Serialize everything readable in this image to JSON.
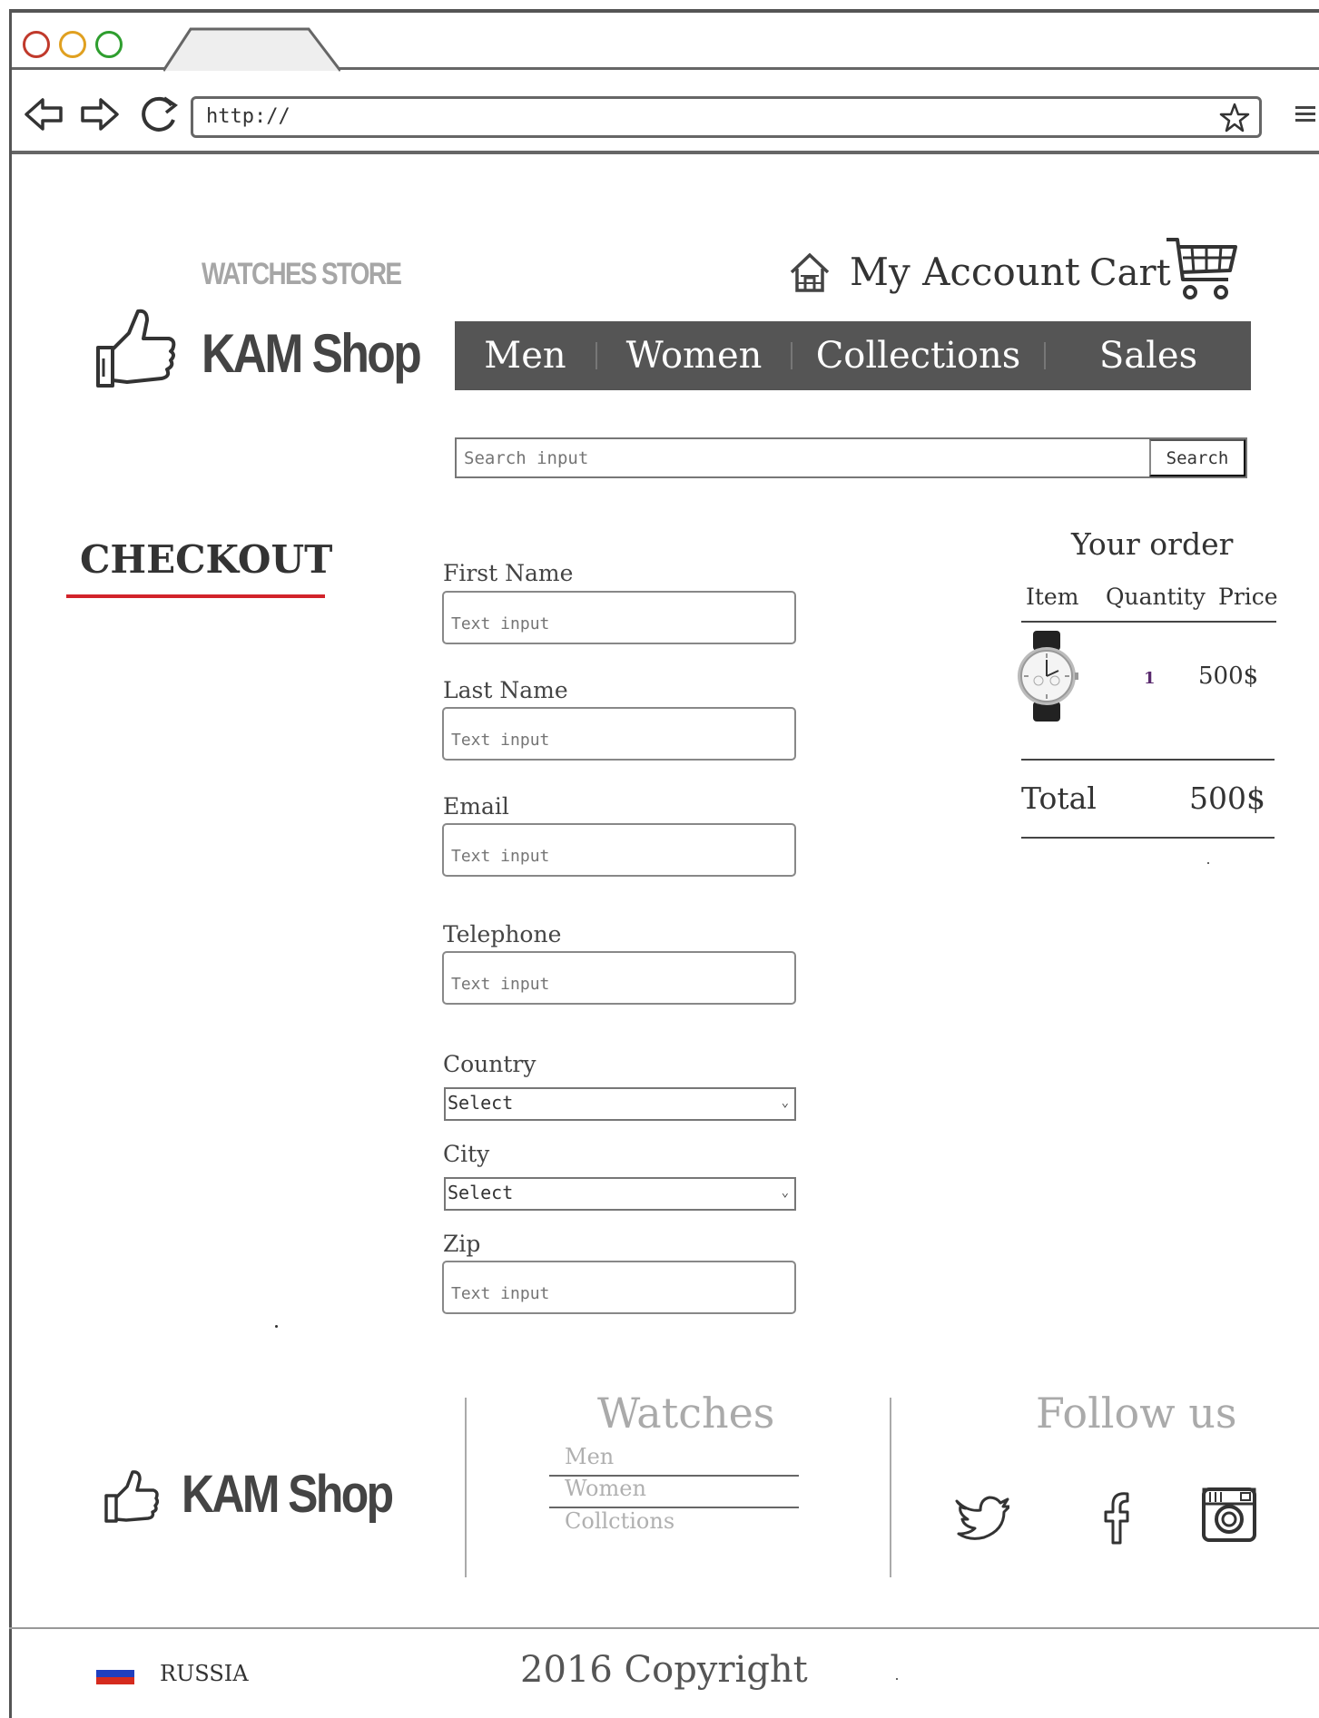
{
  "browser": {
    "address": "http://"
  },
  "header": {
    "store_tag": "WATCHES STORE",
    "logo_text": "KAM Shop",
    "account_label": "My Account",
    "cart_label": "Cart"
  },
  "nav": {
    "items": [
      "Men",
      "Women",
      "Collections",
      "Sales"
    ]
  },
  "search": {
    "placeholder": "Search input",
    "button_label": "Search"
  },
  "checkout": {
    "title": "CHECKOUT",
    "accent_color": "#d2232a",
    "fields": {
      "first_name": {
        "label": "First Name",
        "placeholder": "Text input"
      },
      "last_name": {
        "label": "Last Name",
        "placeholder": "Text input"
      },
      "email": {
        "label": "Email",
        "placeholder": "Text input"
      },
      "telephone": {
        "label": "Telephone",
        "placeholder": "Text input"
      },
      "country": {
        "label": "Country",
        "value": "Select"
      },
      "city": {
        "label": "City",
        "value": "Select"
      },
      "zip": {
        "label": "Zip",
        "placeholder": "Text input"
      }
    }
  },
  "order": {
    "title": "Your order",
    "columns": [
      "Item",
      "Quantity",
      "Price"
    ],
    "items": [
      {
        "image": "wristwatch-image",
        "quantity": "1",
        "price": "500$"
      }
    ],
    "total_label": "Total",
    "total_value": "500$"
  },
  "footer": {
    "logo_text": "KAM Shop",
    "watches_heading": "Watches",
    "watches_links": [
      "Men",
      "Women",
      "Collctions"
    ],
    "follow_heading": "Follow us",
    "social_icons": [
      "twitter-icon",
      "facebook-icon",
      "instagram-icon"
    ],
    "country": "RUSSIA",
    "copyright": "2016 Copyright"
  }
}
